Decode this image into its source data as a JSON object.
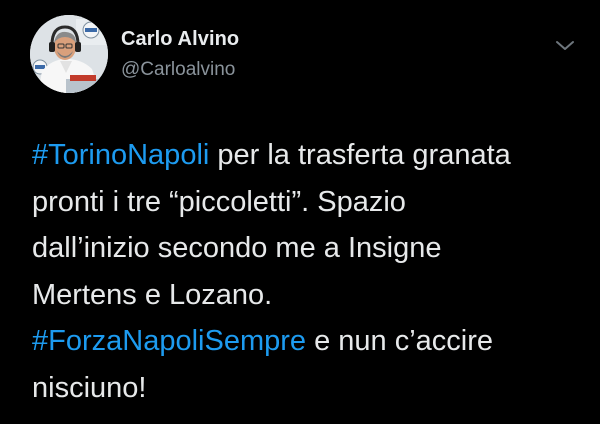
{
  "colors": {
    "background": "#000000",
    "accent": "#1d9bf0",
    "text": "#e7e9ea",
    "secondary": "#8a939b"
  },
  "author": {
    "name": "Carlo Alvino",
    "handle": "@Carloalvino",
    "avatar_icon": "profile-photo"
  },
  "menu_icon": "chevron-down-icon",
  "tweet": {
    "lines": [
      {
        "hashtag": "#TorinoNapoli",
        "text": " per la trasferta granata"
      },
      {
        "text": "pronti i tre “piccoletti”. Spazio"
      },
      {
        "text": "dall’inizio secondo me a Insigne"
      },
      {
        "text": "Mertens e Lozano."
      },
      {
        "hashtag": "#ForzaNapoliSempre",
        "text": " e nun c’accire"
      },
      {
        "text": "nisciuno!"
      }
    ]
  }
}
